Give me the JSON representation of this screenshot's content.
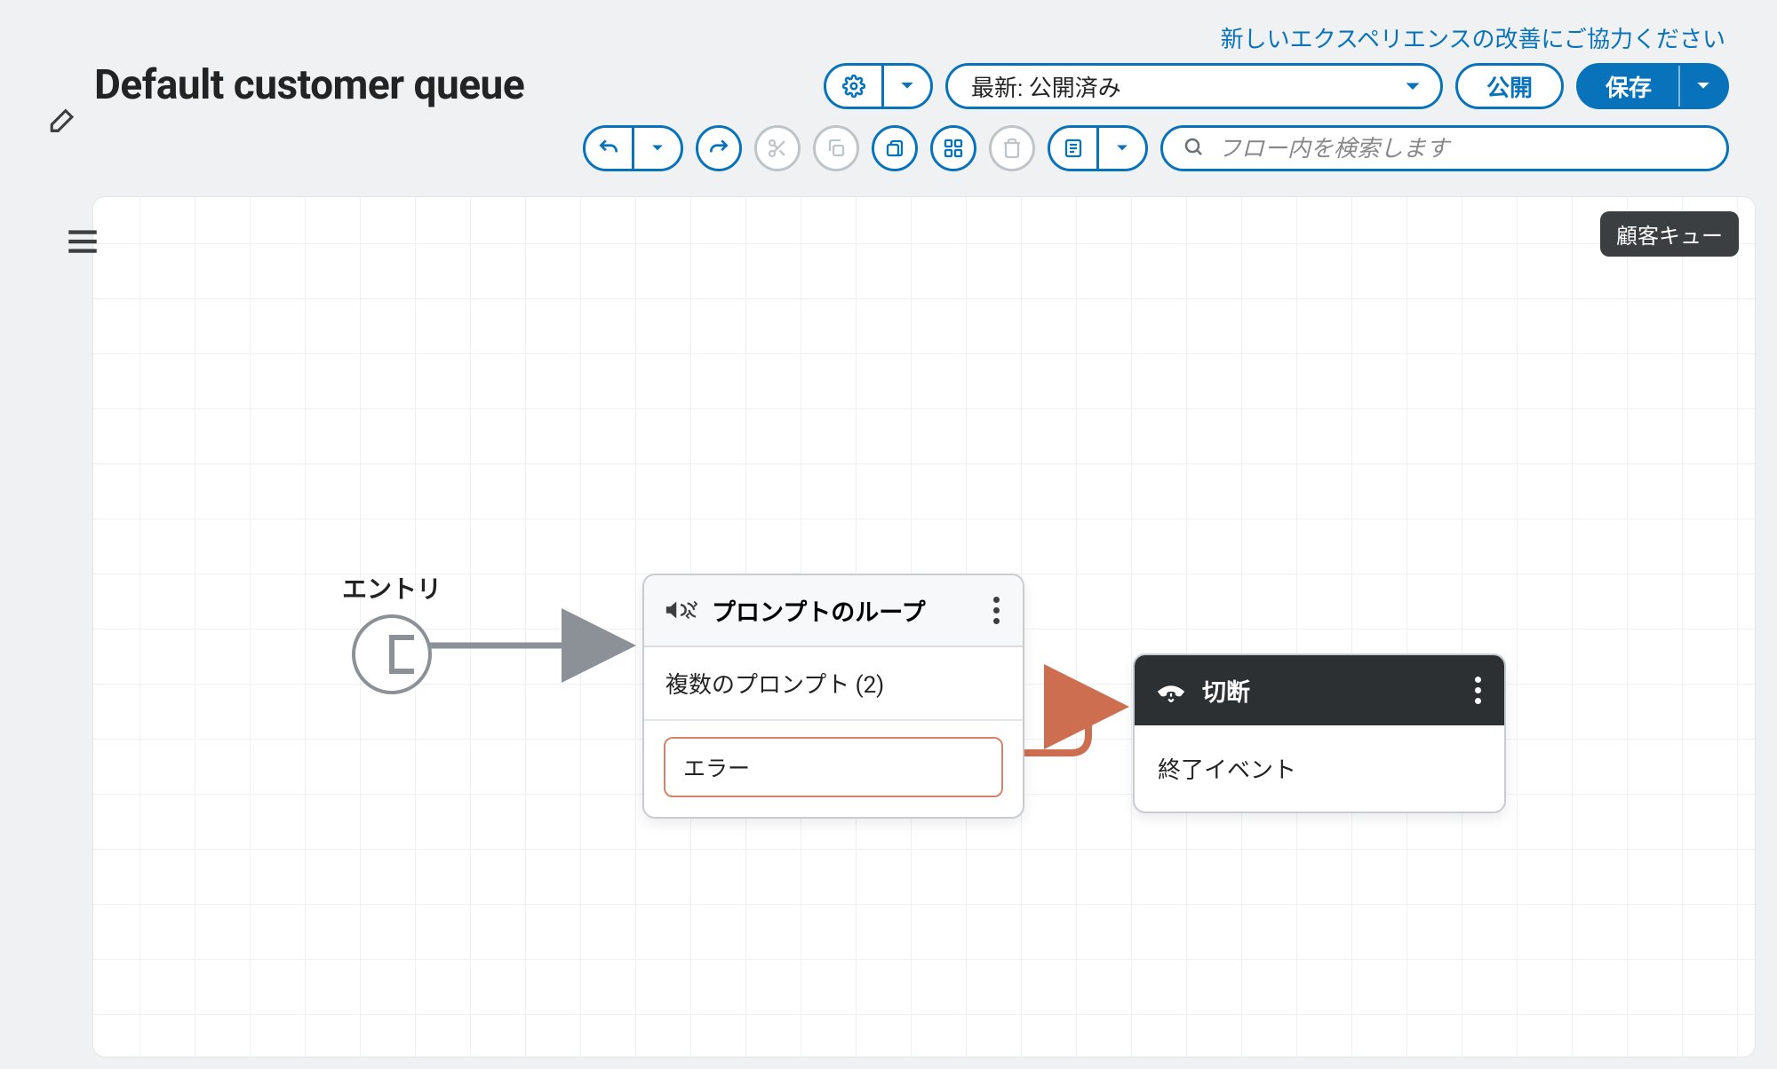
{
  "feedback_link": "新しいエクスペリエンスの改善にご協力ください",
  "page_title": "Default customer queue",
  "toolbar": {
    "version_selected": "最新: 公開済み",
    "publish_label": "公開",
    "save_label": "保存",
    "search_placeholder": "フロー内を検索します"
  },
  "canvas": {
    "badge": "顧客キュー",
    "entry_label": "エントリ",
    "loop_block": {
      "title": "プロンプトのループ",
      "subtitle": "複数のプロンプト (2)",
      "error_label": "エラー"
    },
    "disconnect_block": {
      "title": "切断",
      "subtitle": "終了イベント"
    }
  }
}
